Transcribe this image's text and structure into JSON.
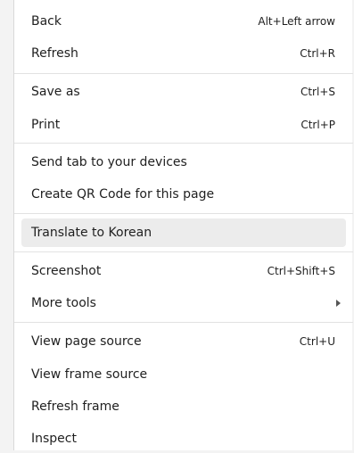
{
  "menu": {
    "items": [
      {
        "label": "Back",
        "shortcut": "Alt+Left arrow"
      },
      {
        "label": "Refresh",
        "shortcut": "Ctrl+R"
      },
      {
        "label": "Save as",
        "shortcut": "Ctrl+S"
      },
      {
        "label": "Print",
        "shortcut": "Ctrl+P"
      },
      {
        "label": "Send tab to your devices",
        "shortcut": ""
      },
      {
        "label": "Create QR Code for this page",
        "shortcut": ""
      },
      {
        "label": "Translate to Korean",
        "shortcut": ""
      },
      {
        "label": "Screenshot",
        "shortcut": "Ctrl+Shift+S"
      },
      {
        "label": "More tools",
        "shortcut": "",
        "icon": "chevron-right-icon"
      },
      {
        "label": "View page source",
        "shortcut": "Ctrl+U"
      },
      {
        "label": "View frame source",
        "shortcut": ""
      },
      {
        "label": "Refresh frame",
        "shortcut": ""
      },
      {
        "label": "Inspect",
        "shortcut": ""
      }
    ],
    "highlighted_item": "Translate to Korean"
  },
  "colors": {
    "menu_background": "#ffffff",
    "highlight": "#ececec",
    "separator": "#e2e2e2",
    "text": "#1f1f1f",
    "page_background": "#f3f3f3"
  }
}
